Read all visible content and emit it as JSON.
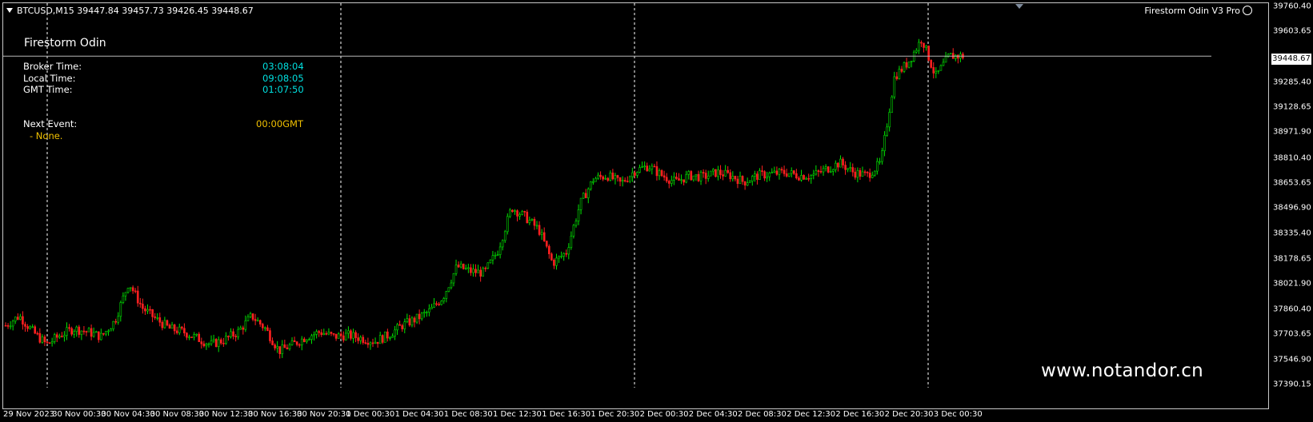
{
  "header": {
    "symbol_line": "BTCUSD,M15  39447.84 39457.73 39426.45 39448.67",
    "indicator_name": "Firestorm Odin V3 Pro"
  },
  "panel": {
    "title": "Firestorm Odin",
    "broker_time_label": "Broker Time:",
    "broker_time_value": "03:08:04",
    "local_time_label": "Local Time:",
    "local_time_value": "09:08:05",
    "gmt_time_label": "GMT Time:",
    "gmt_time_value": "01:07:50",
    "next_event_label": "Next Event:",
    "next_event_value": "00:00GMT",
    "next_event_detail": "- None."
  },
  "watermark": "www.notandor.cn",
  "current_price_label": "39448.67",
  "colors": {
    "background": "#000000",
    "bull": "#00e000",
    "bear": "#ff2020",
    "time_value": "#00e0e0",
    "event_value": "#f0c000"
  },
  "chart_data": {
    "type": "candlestick",
    "title": "",
    "symbol": "BTCUSD",
    "timeframe": "M15",
    "y_ticks": [
      "39760.40",
      "39603.65",
      "39448.67",
      "39285.40",
      "39128.65",
      "38971.90",
      "38810.40",
      "38653.65",
      "38496.90",
      "38335.40",
      "38178.65",
      "38021.90",
      "37860.40",
      "37703.65",
      "37546.90",
      "37390.15"
    ],
    "ylim": [
      37390.15,
      39760.4
    ],
    "x_ticks": [
      "29 Nov 2023",
      "30 Nov 00:30",
      "30 Nov 04:30",
      "30 Nov 08:30",
      "30 Nov 12:30",
      "30 Nov 16:30",
      "30 Nov 20:30",
      "1 Dec 00:30",
      "1 Dec 04:30",
      "1 Dec 08:30",
      "1 Dec 12:30",
      "1 Dec 16:30",
      "1 Dec 20:30",
      "2 Dec 00:30",
      "2 Dec 04:30",
      "2 Dec 08:30",
      "2 Dec 12:30",
      "2 Dec 16:30",
      "2 Dec 20:30",
      "3 Dec 00:30"
    ],
    "day_separators": [
      "30 Nov 00:00",
      "1 Dec 00:00",
      "2 Dec 00:00",
      "3 Dec 00:00"
    ],
    "close_path": [
      37760,
      37820,
      37720,
      37640,
      37700,
      37740,
      37720,
      37690,
      37790,
      38030,
      37870,
      37800,
      37740,
      37720,
      37680,
      37640,
      37670,
      37720,
      37820,
      37740,
      37600,
      37640,
      37690,
      37720,
      37690,
      37700,
      37680,
      37660,
      37700,
      37760,
      37800,
      37850,
      37940,
      38130,
      38100,
      38090,
      38230,
      38500,
      38440,
      38360,
      38150,
      38220,
      38520,
      38680,
      38700,
      38650,
      38730,
      38760,
      38700,
      38660,
      38700,
      38690,
      38720,
      38700,
      38660,
      38700,
      38710,
      38720,
      38700,
      38700,
      38740,
      38780,
      38720,
      38700,
      38780,
      39320,
      39410,
      39560,
      39320,
      39450,
      39449
    ]
  }
}
